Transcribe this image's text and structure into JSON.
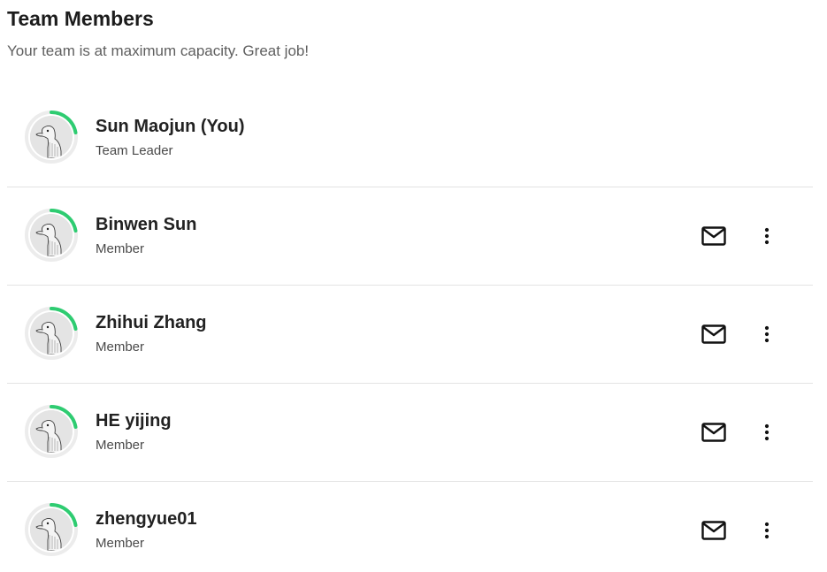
{
  "header": {
    "title": "Team Members",
    "subtitle": "Your team is at maximum capacity. Great job!"
  },
  "colors": {
    "progress_ring": "#2ecc71",
    "ring_track": "#ececec"
  },
  "members": [
    {
      "name": "Sun Maojun (You)",
      "role": "Team Leader",
      "show_actions": false
    },
    {
      "name": "Binwen Sun",
      "role": "Member",
      "show_actions": true
    },
    {
      "name": "Zhihui Zhang",
      "role": "Member",
      "show_actions": true
    },
    {
      "name": "HE yijing",
      "role": "Member",
      "show_actions": true
    },
    {
      "name": "zhengyue01",
      "role": "Member",
      "show_actions": true
    }
  ],
  "icons": {
    "mail": "mail-icon",
    "more": "more-vertical-icon",
    "avatar": "goose-avatar"
  }
}
